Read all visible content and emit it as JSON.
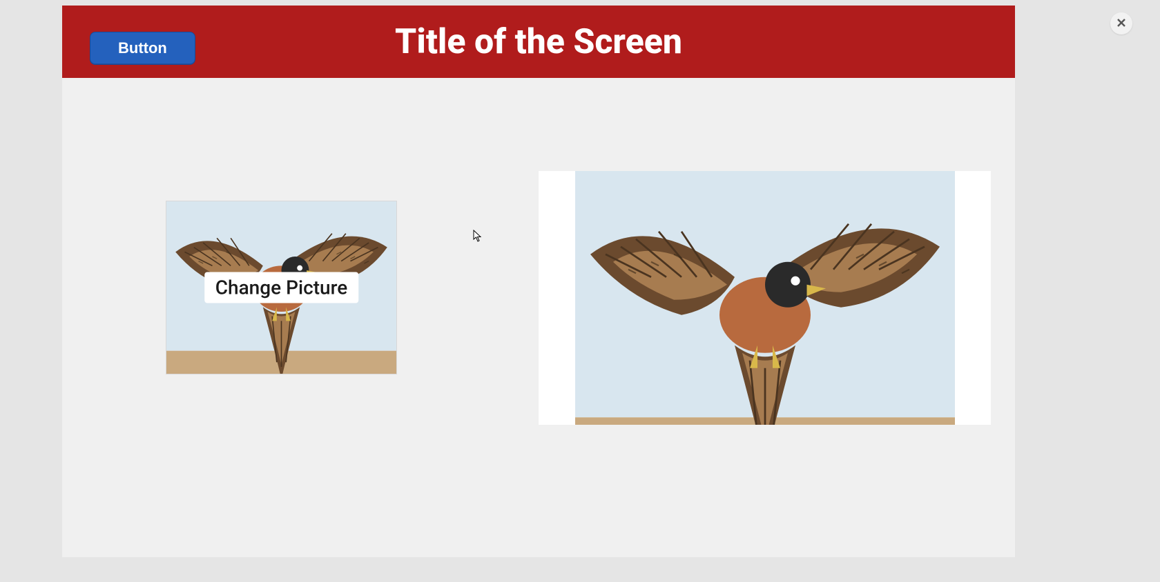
{
  "header": {
    "title": "Title of the Screen",
    "button_label": "Button"
  },
  "thumbnail": {
    "change_label": "Change Picture",
    "alt": "falcon-thumbnail"
  },
  "preview": {
    "alt": "falcon-preview"
  },
  "close": {
    "aria": "Close"
  },
  "colors": {
    "header_bg": "#b01c1c",
    "button_bg": "#2461bd",
    "page_bg": "#e5e5e5"
  }
}
